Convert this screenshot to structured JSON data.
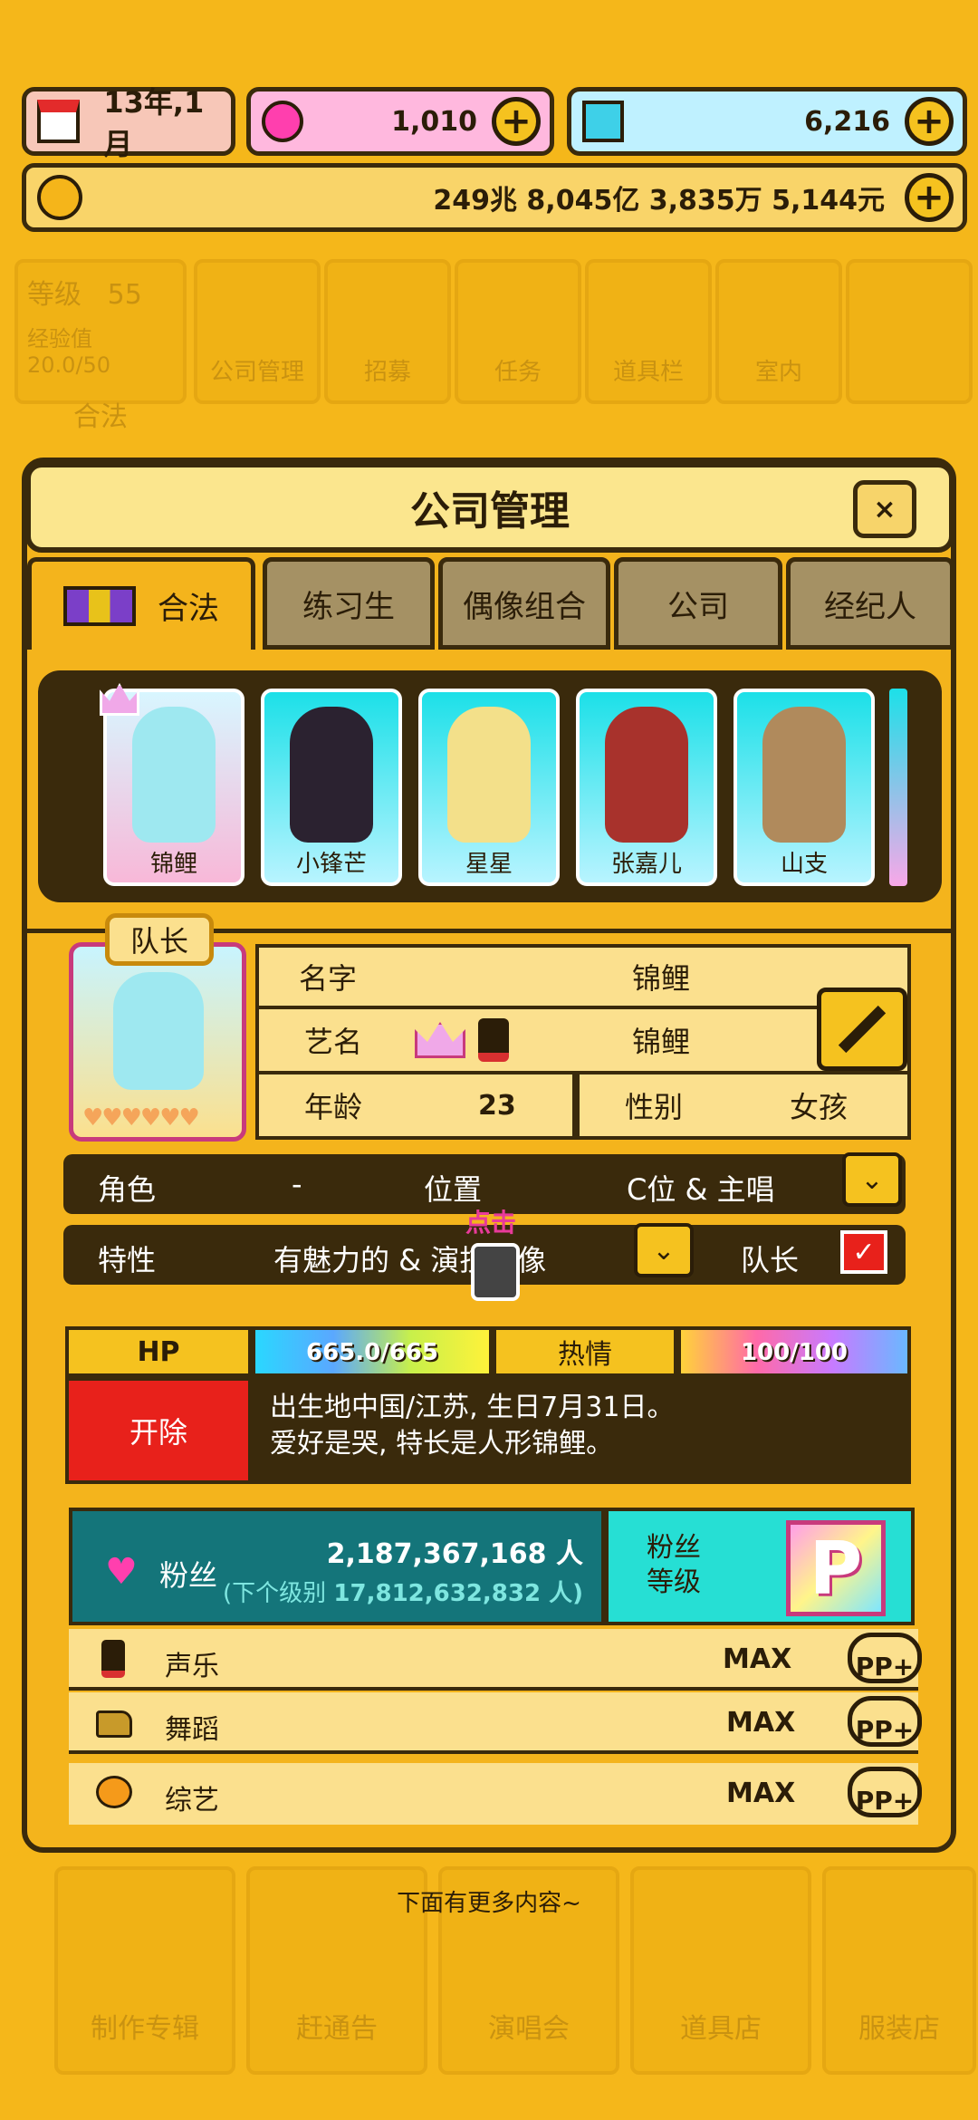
{
  "topbar": {
    "date": "13年,1月",
    "gems_pink": "1,010",
    "gems_blue": "6,216",
    "money": "249兆 8,045亿 3,835万 5,144元"
  },
  "background": {
    "level_label": "等级",
    "level_value": "55",
    "exp_label": "经验值 20.0/50",
    "legal": "合法",
    "menu": [
      "公司管理",
      "招募",
      "任务",
      "道具栏",
      "室内"
    ],
    "bottom_menu": [
      "制作专辑",
      "赶通告",
      "演唱会",
      "道具店",
      "服装店"
    ]
  },
  "dialog": {
    "title": "公司管理",
    "close": "×",
    "tabs": [
      "合法",
      "练习生",
      "偶像组合",
      "公司",
      "经纪人"
    ]
  },
  "roster": [
    {
      "name": "锦鲤"
    },
    {
      "name": "小锋芒"
    },
    {
      "name": "星星"
    },
    {
      "name": "张嘉儿"
    },
    {
      "name": "山支"
    }
  ],
  "profile": {
    "badge": "队长",
    "name_label": "名字",
    "name": "锦鲤",
    "stage_label": "艺名",
    "stage_name": "锦鲤",
    "age_label": "年龄",
    "age": "23",
    "gender_label": "性别",
    "gender": "女孩",
    "role_label": "角色",
    "role": "-",
    "position_label": "位置",
    "position": "C位 & 主唱",
    "trait_label": "特性",
    "trait": "有魅力的 & 演技偶像",
    "tap_hint": "点击",
    "leader_label": "队长"
  },
  "stats": {
    "hp_label": "HP",
    "hp_value": "665.0/665",
    "hp_fraction": 1.0,
    "passion_label": "热情",
    "passion_value": "100/100",
    "passion_fraction": 1.0,
    "fire_label": "开除",
    "bio": "出生地中国/江苏, 生日7月31日。\n爱好是哭, 特长是人形锦鲤。"
  },
  "fans": {
    "label": "粉丝",
    "count": "2,187,367,168 人",
    "next_prefix": "(下个级别",
    "next_value": "17,812,632,832 人)",
    "level_label": "粉丝\n等级",
    "grade": "P"
  },
  "skills": [
    {
      "name": "声乐",
      "value": "MAX",
      "btn": "PP+"
    },
    {
      "name": "舞蹈",
      "value": "MAX",
      "btn": "PP+"
    },
    {
      "name": "综艺",
      "value": "MAX",
      "btn": "PP+"
    }
  ],
  "footer_hint": "下面有更多内容~",
  "colors": {
    "bg": "#f5b71a",
    "dark": "#3a2a0c",
    "fire": "#e8211b",
    "fans_bg": "#14757a",
    "fans_grade_bg": "#26dfd4"
  }
}
